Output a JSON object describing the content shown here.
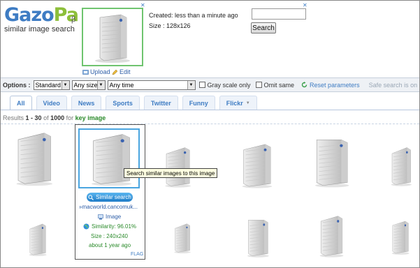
{
  "logo": {
    "part1": "Gazo",
    "part2": "Pa",
    "beta": "β",
    "tagline": "similar image search"
  },
  "ad_marker": "✕",
  "query": {
    "created": "Created: less than a minute ago",
    "size": "Size : 128x126",
    "upload_label": "Upload",
    "edit_label": "Edit"
  },
  "search": {
    "input_value": "",
    "button_label": "Search"
  },
  "options": {
    "label": "Options :",
    "type_select": "Standard",
    "size_select": "Any size",
    "time_select": "Any time",
    "grayscale_label": "Gray scale only",
    "omit_label": "Omit same",
    "reset_label": "Reset parameters",
    "safe_label": "Safe search is on"
  },
  "tabs": [
    {
      "label": "All"
    },
    {
      "label": "Video"
    },
    {
      "label": "News"
    },
    {
      "label": "Sports"
    },
    {
      "label": "Twitter"
    },
    {
      "label": "Funny"
    },
    {
      "label": "Flickr"
    }
  ],
  "results": {
    "prefix": "Results",
    "range": "1 - 30",
    "of": "of",
    "total": "1000",
    "for": "for",
    "keyword": "key image"
  },
  "hover_card": {
    "tooltip": "Search similar images to this image",
    "similar_button": "Similar search",
    "source": "»macworld.cancomuk...",
    "image_link": "Image",
    "similarity": "Similarity: 96.01%",
    "size": "Size : 240x240",
    "age": "about 1 year ago",
    "flag": "FLAG"
  },
  "colors": {
    "brand_blue": "#3e7cc3",
    "brand_green": "#8dbf3a",
    "highlight_border": "#4aa5e0",
    "query_border": "#6fc46f"
  }
}
